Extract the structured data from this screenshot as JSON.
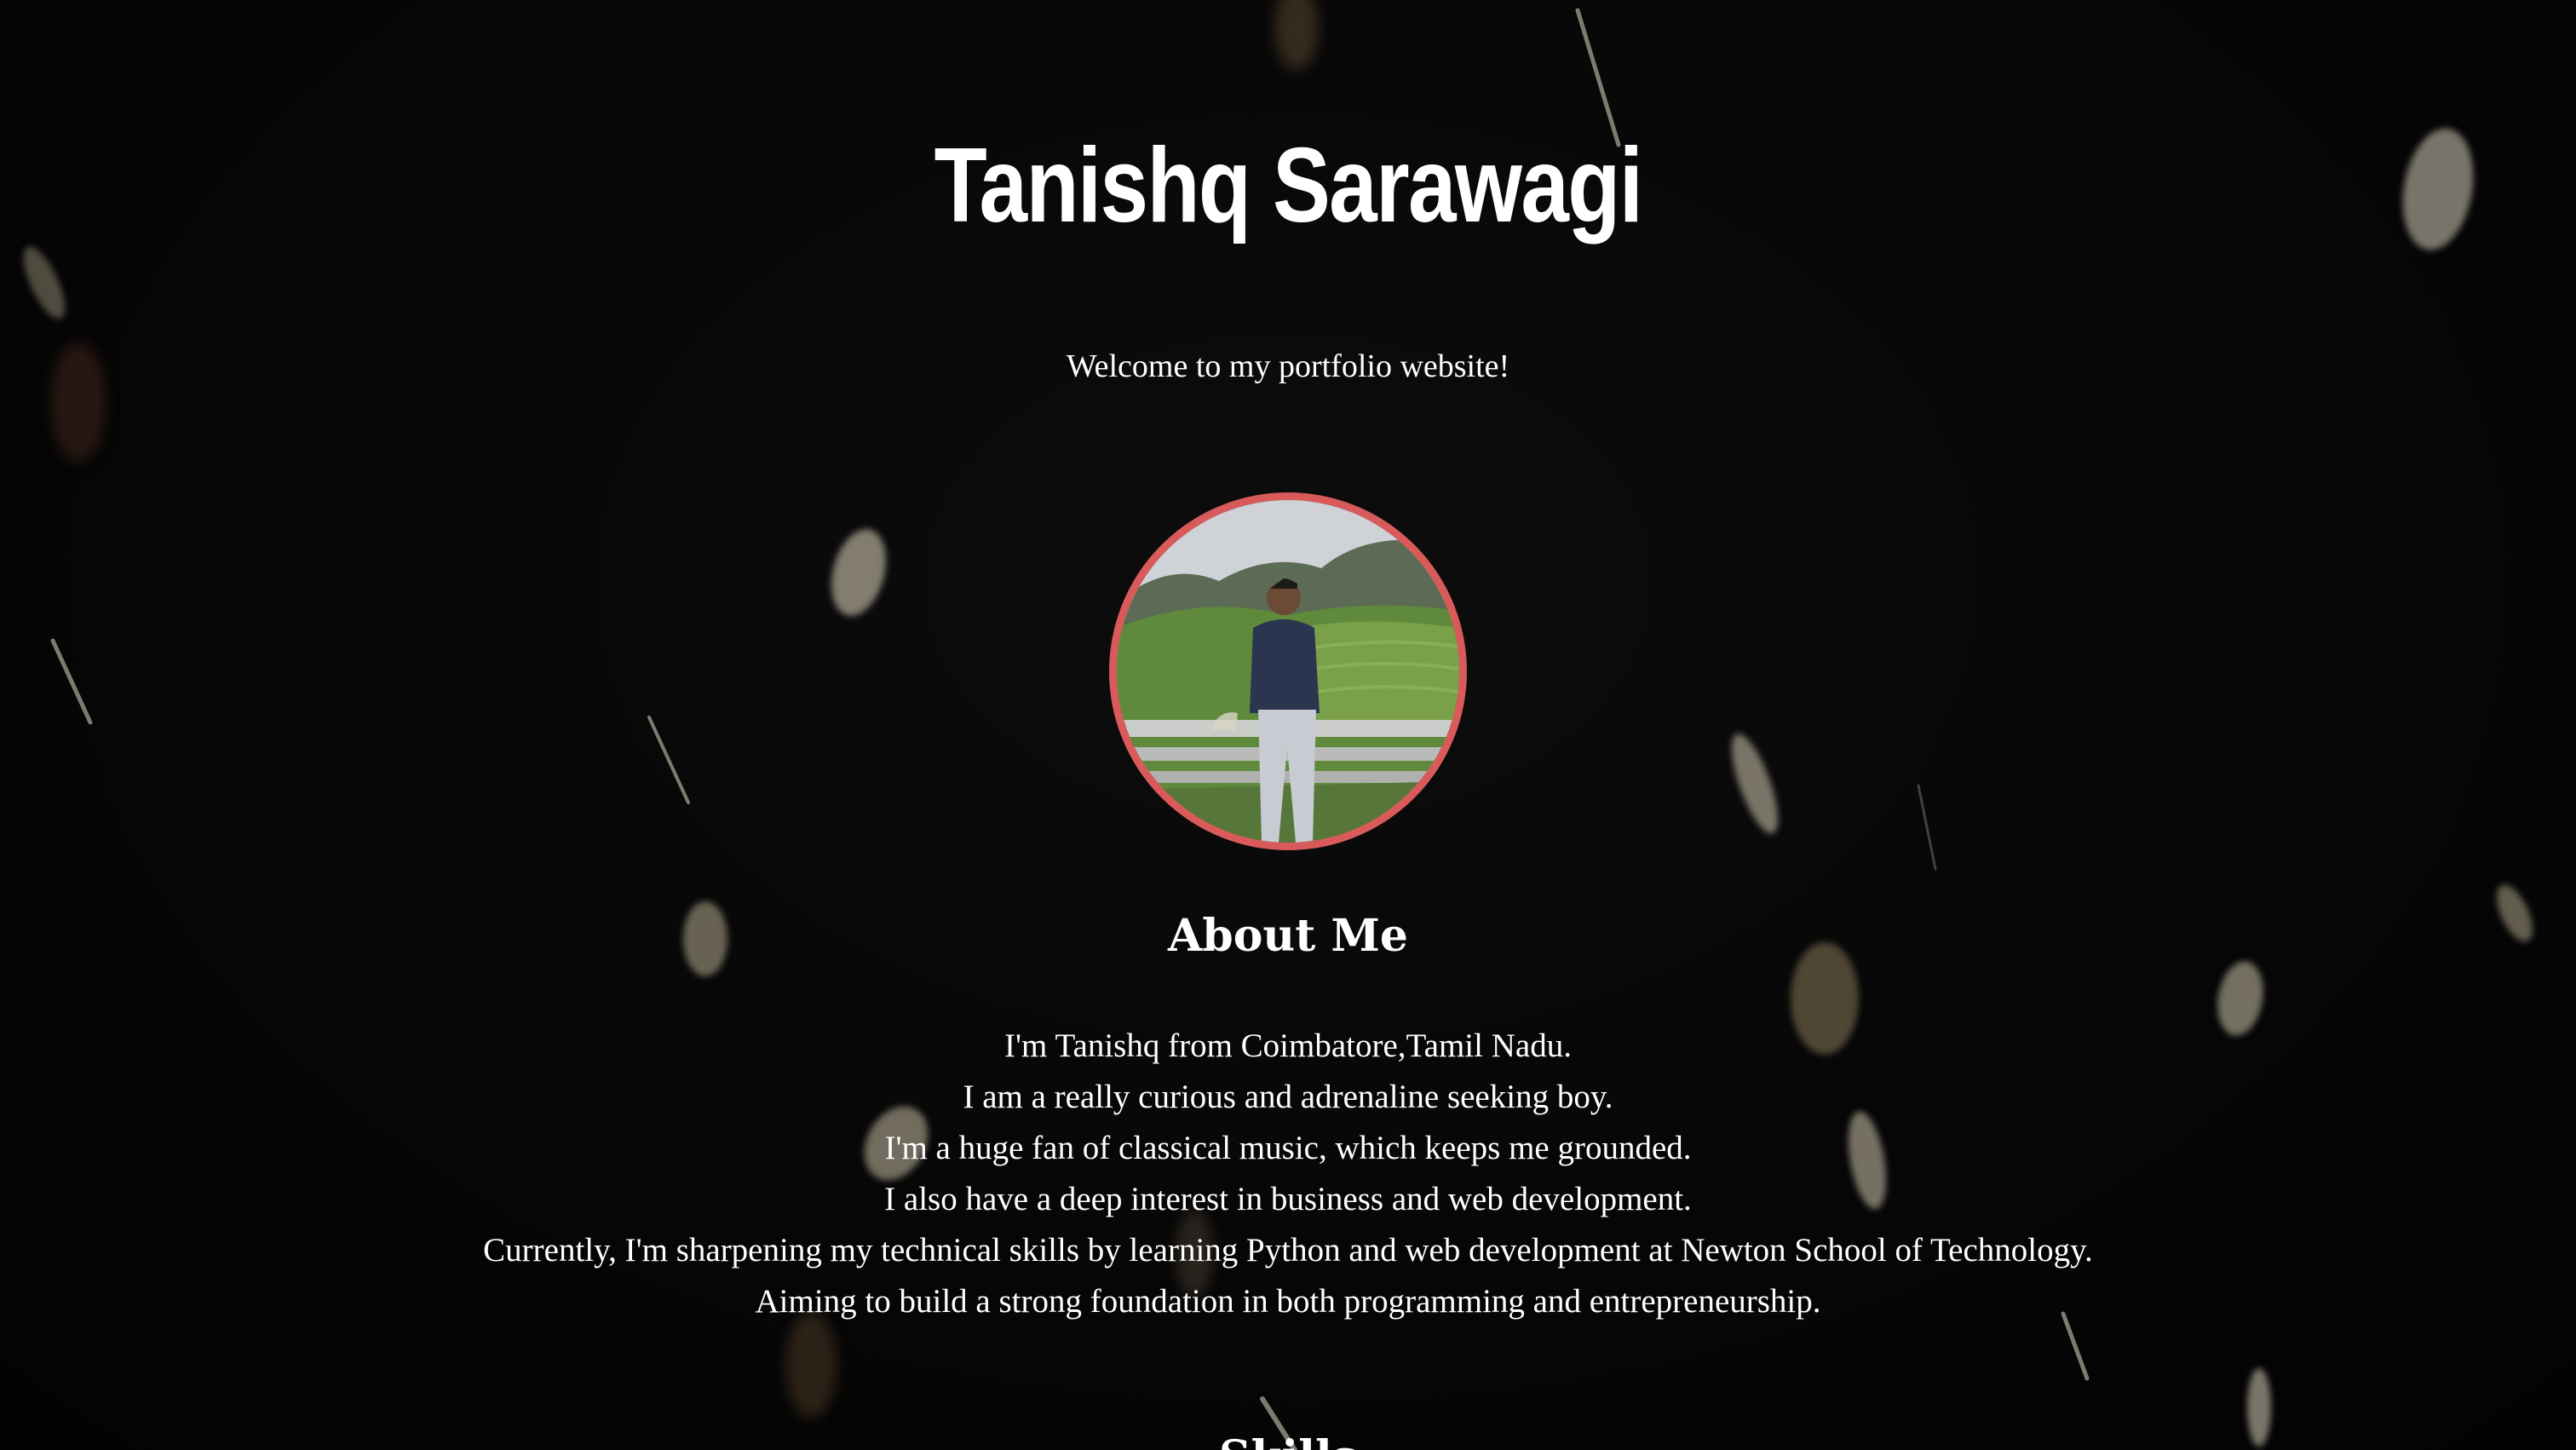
{
  "header": {
    "title": "Tanishq Sarawagi",
    "tagline": "Welcome to my portfolio website!"
  },
  "profile": {
    "image": "profile-photo",
    "border_color": "#d85a5a"
  },
  "about": {
    "heading": "About Me",
    "lines": [
      "I'm Tanishq from Coimbatore,Tamil Nadu.",
      "I am a really curious and adrenaline seeking boy.",
      "I'm a huge fan of classical music, which keeps me grounded.",
      "I also have a deep interest in business and web development.",
      "Currently, I'm sharpening my technical skills by learning Python and web development at Newton School of Technology.",
      "Aiming to build a strong foundation in both programming and entrepreneurship."
    ]
  },
  "skills": {
    "heading": "Skills"
  },
  "colors": {
    "background": "#050505",
    "text": "#ffffff",
    "accent": "#d85a5a"
  }
}
